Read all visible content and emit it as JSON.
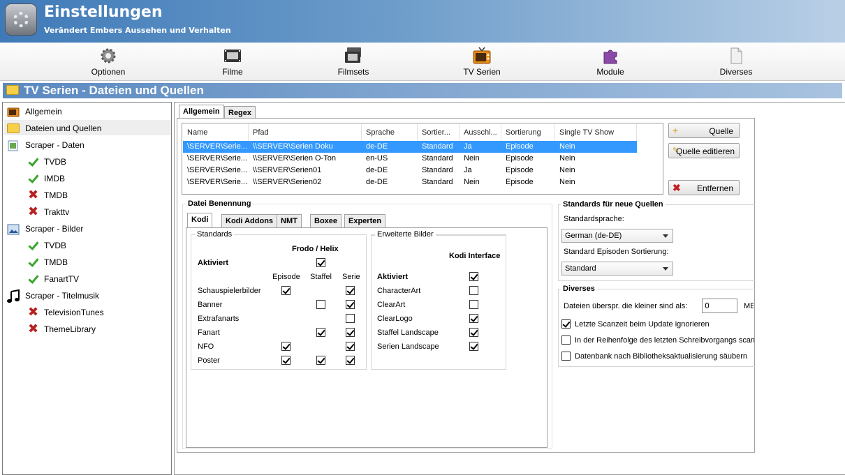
{
  "header": {
    "title": "Einstellungen",
    "subtitle": "Verändert Embers Aussehen und Verhalten"
  },
  "toolbar": [
    {
      "label": "Optionen",
      "icon": "gear-icon"
    },
    {
      "label": "Filme",
      "icon": "film-icon"
    },
    {
      "label": "Filmsets",
      "icon": "filmsets-icon"
    },
    {
      "label": "TV Serien",
      "icon": "tv-icon"
    },
    {
      "label": "Module",
      "icon": "puzzle-icon"
    },
    {
      "label": "Diverses",
      "icon": "document-icon"
    }
  ],
  "section_title": "TV Serien - Dateien und Quellen",
  "tree": [
    {
      "label": "Allgemein",
      "icon": "tv-icon"
    },
    {
      "label": "Dateien und Quellen",
      "icon": "folder-icon",
      "selected": true
    },
    {
      "label": "Scraper - Daten",
      "icon": "scraper-data-icon"
    },
    {
      "label": "TVDB",
      "icon": "check-icon"
    },
    {
      "label": "IMDB",
      "icon": "check-icon"
    },
    {
      "label": "TMDB",
      "icon": "cross-icon"
    },
    {
      "label": "Trakttv",
      "icon": "cross-icon"
    },
    {
      "label": "Scraper - Bilder",
      "icon": "scraper-images-icon"
    },
    {
      "label": "TVDB",
      "icon": "check-icon"
    },
    {
      "label": "TMDB",
      "icon": "check-icon"
    },
    {
      "label": "FanartTV",
      "icon": "check-icon"
    },
    {
      "label": "Scraper - Titelmusik",
      "icon": "music-icon"
    },
    {
      "label": "TelevisionTunes",
      "icon": "cross-icon"
    },
    {
      "label": "ThemeLibrary",
      "icon": "cross-icon"
    }
  ],
  "tabs": {
    "main": [
      "Allgemein",
      "Regex"
    ],
    "naming": [
      "Kodi",
      "Kodi Addons",
      "NMT",
      "Boxee",
      "Experten"
    ]
  },
  "sources": {
    "columns": [
      "Name",
      "Pfad",
      "Sprache",
      "Sortier...",
      "Ausschl...",
      "Sortierung",
      "Single TV Show"
    ],
    "rows": [
      [
        "\\SERVER\\Serie...",
        "\\\\SERVER\\Serien Doku",
        "de-DE",
        "Standard",
        "Ja",
        "Episode",
        "Nein"
      ],
      [
        "\\SERVER\\Serie...",
        "\\\\SERVER\\Serien O-Ton",
        "en-US",
        "Standard",
        "Nein",
        "Episode",
        "Nein"
      ],
      [
        "\\SERVER\\Serie...",
        "\\\\SERVER\\Serien01",
        "de-DE",
        "Standard",
        "Ja",
        "Episode",
        "Nein"
      ],
      [
        "\\SERVER\\Serie...",
        "\\\\SERVER\\Serien02",
        "de-DE",
        "Standard",
        "Nein",
        "Episode",
        "Nein"
      ]
    ]
  },
  "buttons": {
    "add": "Quelle",
    "edit": "Quelle editieren",
    "remove": "Entfernen"
  },
  "naming": {
    "group_title": "Datei Benennung",
    "standards_title": "Standards",
    "standards_header": "Frodo / Helix",
    "activated": "Aktiviert",
    "cols": [
      "Episode",
      "Staffel",
      "Serie"
    ],
    "rows": [
      {
        "label": "Schauspielerbilder",
        "checks": [
          true,
          null,
          true
        ]
      },
      {
        "label": "Banner",
        "checks": [
          null,
          false,
          true
        ]
      },
      {
        "label": "Extrafanarts",
        "checks": [
          null,
          null,
          false
        ]
      },
      {
        "label": "Fanart",
        "checks": [
          null,
          true,
          true
        ]
      },
      {
        "label": "NFO",
        "checks": [
          true,
          null,
          true
        ]
      },
      {
        "label": "Poster",
        "checks": [
          true,
          true,
          true
        ]
      }
    ],
    "extended_title": "Erweiterte Bilder",
    "extended_header": "Kodi Interface",
    "extended_rows": [
      {
        "label": "Aktiviert",
        "checked": true
      },
      {
        "label": "CharacterArt",
        "checked": false
      },
      {
        "label": "ClearArt",
        "checked": false
      },
      {
        "label": "ClearLogo",
        "checked": true
      },
      {
        "label": "Staffel Landscape",
        "checked": true
      },
      {
        "label": "Serien Landscape",
        "checked": true
      }
    ]
  },
  "defaults": {
    "title": "Standards für neue Quellen",
    "language_label": "Standardsprache:",
    "language_value": "German (de-DE)",
    "sort_label": "Standard Episoden Sortierung:",
    "sort_value": "Standard"
  },
  "misc": {
    "title": "Diverses",
    "skip_label": "Dateien überspr. die kleiner sind als:",
    "skip_value": "0",
    "skip_unit": "MB",
    "options": [
      {
        "label": "Letzte Scanzeit beim Update ignorieren",
        "checked": true
      },
      {
        "label": "In der Reihenfolge des letzten Schreibvorgangs scannen",
        "checked": false
      },
      {
        "label": "Datenbank nach Bibliotheksaktualisierung säubern",
        "checked": false
      }
    ]
  }
}
